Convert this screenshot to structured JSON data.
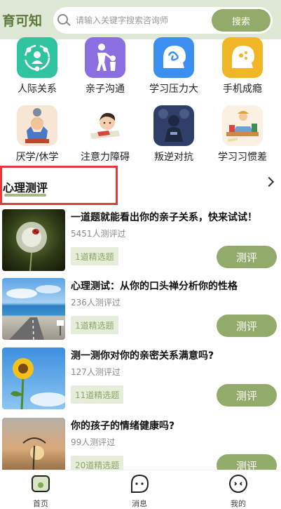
{
  "header": {
    "brand": "育可知",
    "search_placeholder": "请输入关键字搜索咨询师",
    "search_button": "搜索"
  },
  "categories": [
    {
      "label": "人际关系",
      "icon": "people-network-icon",
      "color": "#2fc3a0"
    },
    {
      "label": "亲子沟通",
      "icon": "parent-child-icon",
      "color": "#8b6fe0"
    },
    {
      "label": "学习压力大",
      "icon": "stressed-head-icon",
      "color": "#3b8ff0"
    },
    {
      "label": "手机成瘾",
      "icon": "phone-addiction-icon",
      "color": "#f1b526"
    },
    {
      "label": "厌学/休学",
      "icon": "frustrated-student-icon",
      "color": "#f7e6d4"
    },
    {
      "label": "注意力障碍",
      "icon": "distracted-child-icon",
      "color": "#ffffff"
    },
    {
      "label": "叛逆对抗",
      "icon": "rebellious-teen-icon",
      "color": "#2f3f6a"
    },
    {
      "label": "学习习惯差",
      "icon": "messy-desk-icon",
      "color": "#faf1e2"
    }
  ],
  "section": {
    "title": "心理测评"
  },
  "articles": [
    {
      "title": "一道题就能看出你的亲子关系，快来试试！",
      "count": "5451人测评过",
      "tag": "1道精选题",
      "button": "测评",
      "image": "dandelion-ladybug"
    },
    {
      "title": "心理测试：从你的口头禅分析你的性格",
      "count": "236人测评过",
      "tag": "1道精选题",
      "button": "测评",
      "image": "seaside-road"
    },
    {
      "title": "测一测你对你的亲密关系满意吗?",
      "count": "127人测评过",
      "tag": "11道精选题",
      "button": "测评",
      "image": "sunflower-sky"
    },
    {
      "title": "你的孩子的情绪健康吗?",
      "count": "99人测评过",
      "tag": "20道精选题",
      "button": "测评",
      "image": "sunset-field"
    }
  ],
  "tabbar": [
    {
      "label": "首页",
      "icon": "home-icon",
      "active": true
    },
    {
      "label": "消息",
      "icon": "message-icon",
      "active": false
    },
    {
      "label": "我的",
      "icon": "profile-icon",
      "active": false
    }
  ],
  "colors": {
    "accent": "#92ab6a",
    "header_bg": "#dfe8d4",
    "highlight_frame": "#e03a3a"
  }
}
